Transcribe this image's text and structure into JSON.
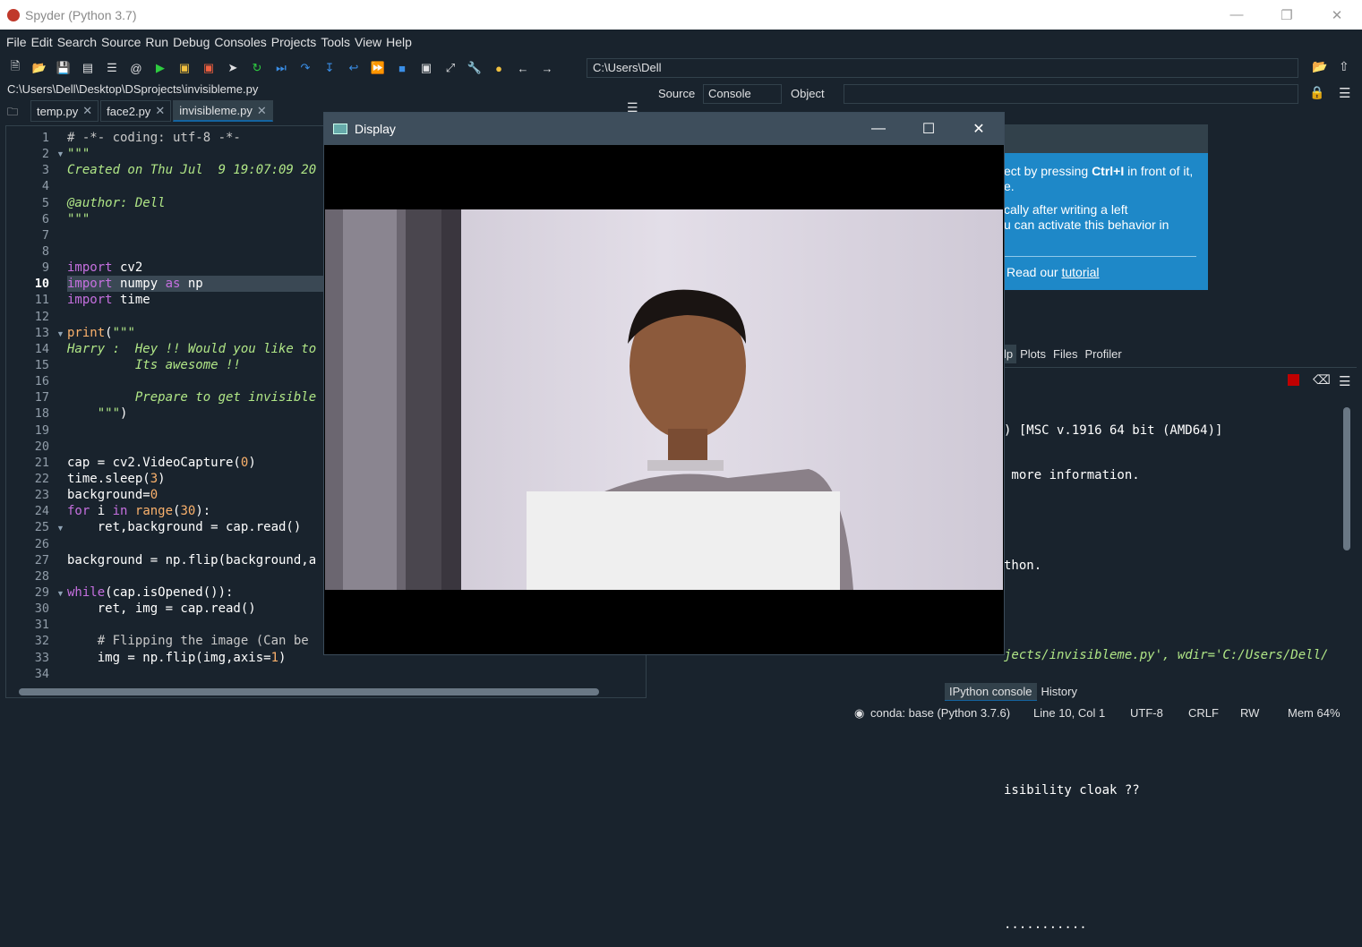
{
  "window": {
    "title": "Spyder (Python 3.7)"
  },
  "menu": [
    "File",
    "Edit",
    "Search",
    "Source",
    "Run",
    "Debug",
    "Consoles",
    "Projects",
    "Tools",
    "View",
    "Help"
  ],
  "toolbar": {
    "working_dir": "C:\\Users\\Dell"
  },
  "editor": {
    "file_path": "C:\\Users\\Dell\\Desktop\\DSprojects\\invisibleme.py",
    "tabs": [
      {
        "label": "temp.py",
        "active": false
      },
      {
        "label": "face2.py",
        "active": false
      },
      {
        "label": "invisibleme.py",
        "active": true
      }
    ],
    "current_line": 10,
    "line_numbers": [
      "1",
      "2",
      "3",
      "4",
      "5",
      "6",
      "7",
      "8",
      "9",
      "10",
      "11",
      "12",
      "13",
      "14",
      "15",
      "16",
      "17",
      "18",
      "19",
      "20",
      "21",
      "22",
      "23",
      "24",
      "25",
      "26",
      "27",
      "28",
      "29",
      "30",
      "31",
      "32",
      "33",
      "34"
    ]
  },
  "inspector": {
    "source_label": "Source",
    "source_value": "Console",
    "object_label": "Object"
  },
  "help_card": {
    "line1_pre": "ect by pressing ",
    "line1_bold": "Ctrl+I",
    "line1_post": " in front of it,",
    "line2": "e.",
    "line3": "cally after writing a left",
    "line4": "u can activate this behavior in",
    "read_pre": "Read our ",
    "read_link": "tutorial"
  },
  "pane_tabs": [
    "lp",
    "Plots",
    "Files",
    "Profiler"
  ],
  "console": {
    "lines": [
      ") [MSC v.1916 64 bit (AMD64)]",
      " more information.",
      "",
      "thon.",
      "",
      "jects/invisibleme.py', wdir='C:/Users/Dell/",
      "",
      "",
      "isibility cloak ??",
      "",
      "",
      "..........."
    ],
    "tabs": [
      "IPython console",
      "History"
    ]
  },
  "status": {
    "conda": "conda: base (Python 3.7.6)",
    "position": "Line 10, Col 1",
    "encoding": "UTF-8",
    "eol": "CRLF",
    "rw": "RW",
    "mem": "Mem 64%"
  },
  "display_window": {
    "title": "Display"
  },
  "colors": {
    "bg": "#19232d",
    "accent": "#1464a0",
    "help_bg": "#1e88c8"
  }
}
